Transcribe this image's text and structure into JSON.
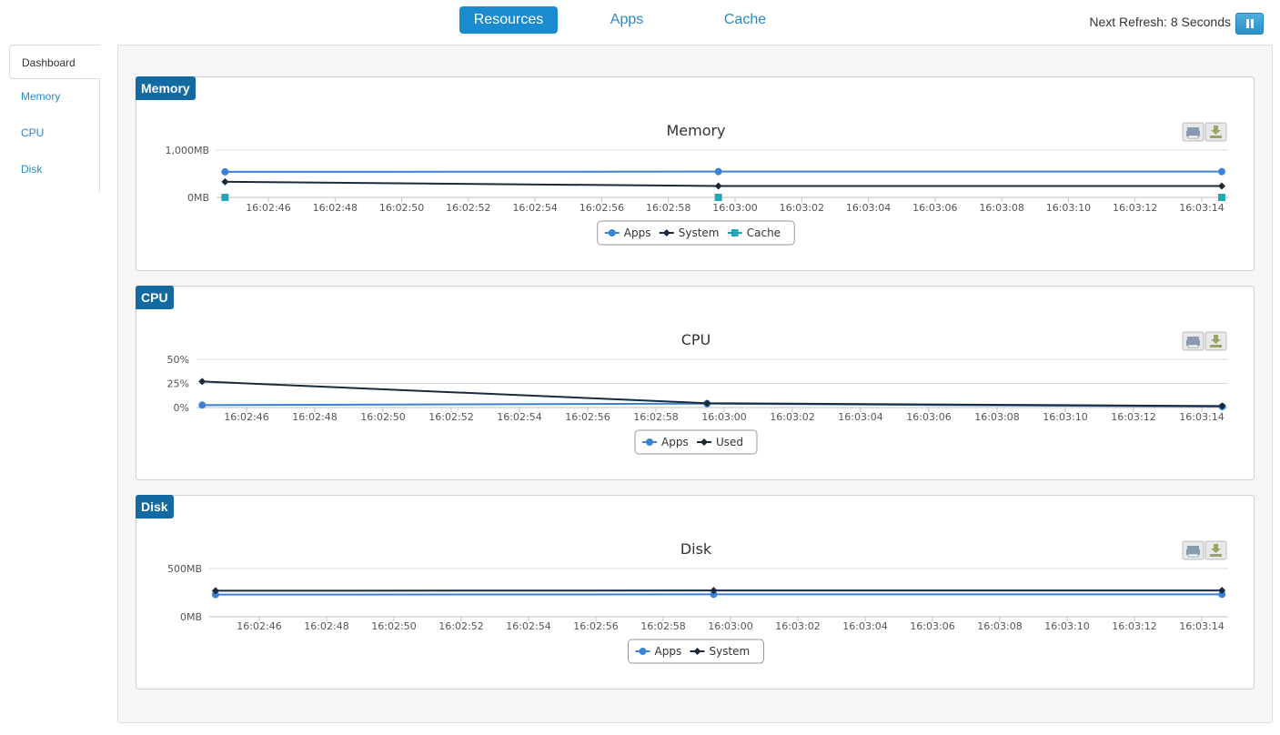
{
  "nav": {
    "tabs": [
      {
        "label": "Resources",
        "active": true
      },
      {
        "label": "Apps",
        "active": false
      },
      {
        "label": "Cache",
        "active": false
      }
    ],
    "refresh_text": "Next Refresh: 8 Seconds"
  },
  "sidebar": {
    "items": [
      {
        "label": "Dashboard",
        "active": true
      },
      {
        "label": "Memory",
        "active": false
      },
      {
        "label": "CPU",
        "active": false
      },
      {
        "label": "Disk",
        "active": false
      }
    ]
  },
  "icons": {
    "pause": "pause-icon",
    "print": "print-icon",
    "download": "download-icon"
  },
  "colors": {
    "accent": "#1a8bcf",
    "tag": "#136aa0",
    "apps": "#3b82d6",
    "system": "#1b2a3a",
    "cache": "#23a7b8"
  },
  "x_ticks": [
    "16:02:46",
    "16:02:48",
    "16:02:50",
    "16:02:52",
    "16:02:54",
    "16:02:56",
    "16:02:58",
    "16:03:00",
    "16:03:02",
    "16:03:04",
    "16:03:06",
    "16:03:08",
    "16:03:10",
    "16:03:12",
    "16:03:14"
  ],
  "chart_data": [
    {
      "type": "line",
      "tag": "Memory",
      "title": "Memory",
      "y_ticks": [
        "0MB",
        "1,000MB"
      ],
      "ylim": [
        0,
        1000
      ],
      "x_range": [
        "16:02:44.5",
        "16:03:15"
      ],
      "legend_position": "bottom-center",
      "series": [
        {
          "name": "Apps",
          "marker": "circle",
          "x": [
            "16:02:44.7",
            "16:02:59.5",
            "16:03:14.6"
          ],
          "values": [
            540,
            545,
            545
          ]
        },
        {
          "name": "System",
          "marker": "diamond",
          "x": [
            "16:02:44.7",
            "16:02:59.5",
            "16:03:14.6"
          ],
          "values": [
            330,
            240,
            240
          ]
        },
        {
          "name": "Cache",
          "marker": "square",
          "x": [
            "16:02:44.7",
            "16:02:59.5",
            "16:03:14.6"
          ],
          "values": [
            0,
            0,
            0
          ]
        }
      ]
    },
    {
      "type": "line",
      "tag": "CPU",
      "title": "CPU",
      "y_ticks": [
        "0%",
        "25%",
        "50%"
      ],
      "ylim": [
        0,
        50
      ],
      "x_range": [
        "16:02:44.5",
        "16:03:15"
      ],
      "legend_position": "bottom-center",
      "series": [
        {
          "name": "Apps",
          "marker": "circle",
          "x": [
            "16:02:44.7",
            "16:02:59.5",
            "16:03:14.6"
          ],
          "values": [
            2.5,
            4,
            1
          ]
        },
        {
          "name": "Used",
          "marker": "diamond",
          "x": [
            "16:02:44.7",
            "16:02:59.5",
            "16:03:14.6"
          ],
          "values": [
            27,
            4.5,
            1.5
          ]
        }
      ]
    },
    {
      "type": "line",
      "tag": "Disk",
      "title": "Disk",
      "y_ticks": [
        "0MB",
        "500MB"
      ],
      "ylim": [
        0,
        500
      ],
      "x_range": [
        "16:02:44.5",
        "16:03:15"
      ],
      "legend_position": "bottom-center",
      "series": [
        {
          "name": "Apps",
          "marker": "circle",
          "x": [
            "16:02:44.7",
            "16:02:59.5",
            "16:03:14.6"
          ],
          "values": [
            230,
            232,
            232
          ]
        },
        {
          "name": "System",
          "marker": "diamond",
          "x": [
            "16:02:44.7",
            "16:02:59.5",
            "16:03:14.6"
          ],
          "values": [
            270,
            272,
            272
          ]
        }
      ]
    }
  ]
}
